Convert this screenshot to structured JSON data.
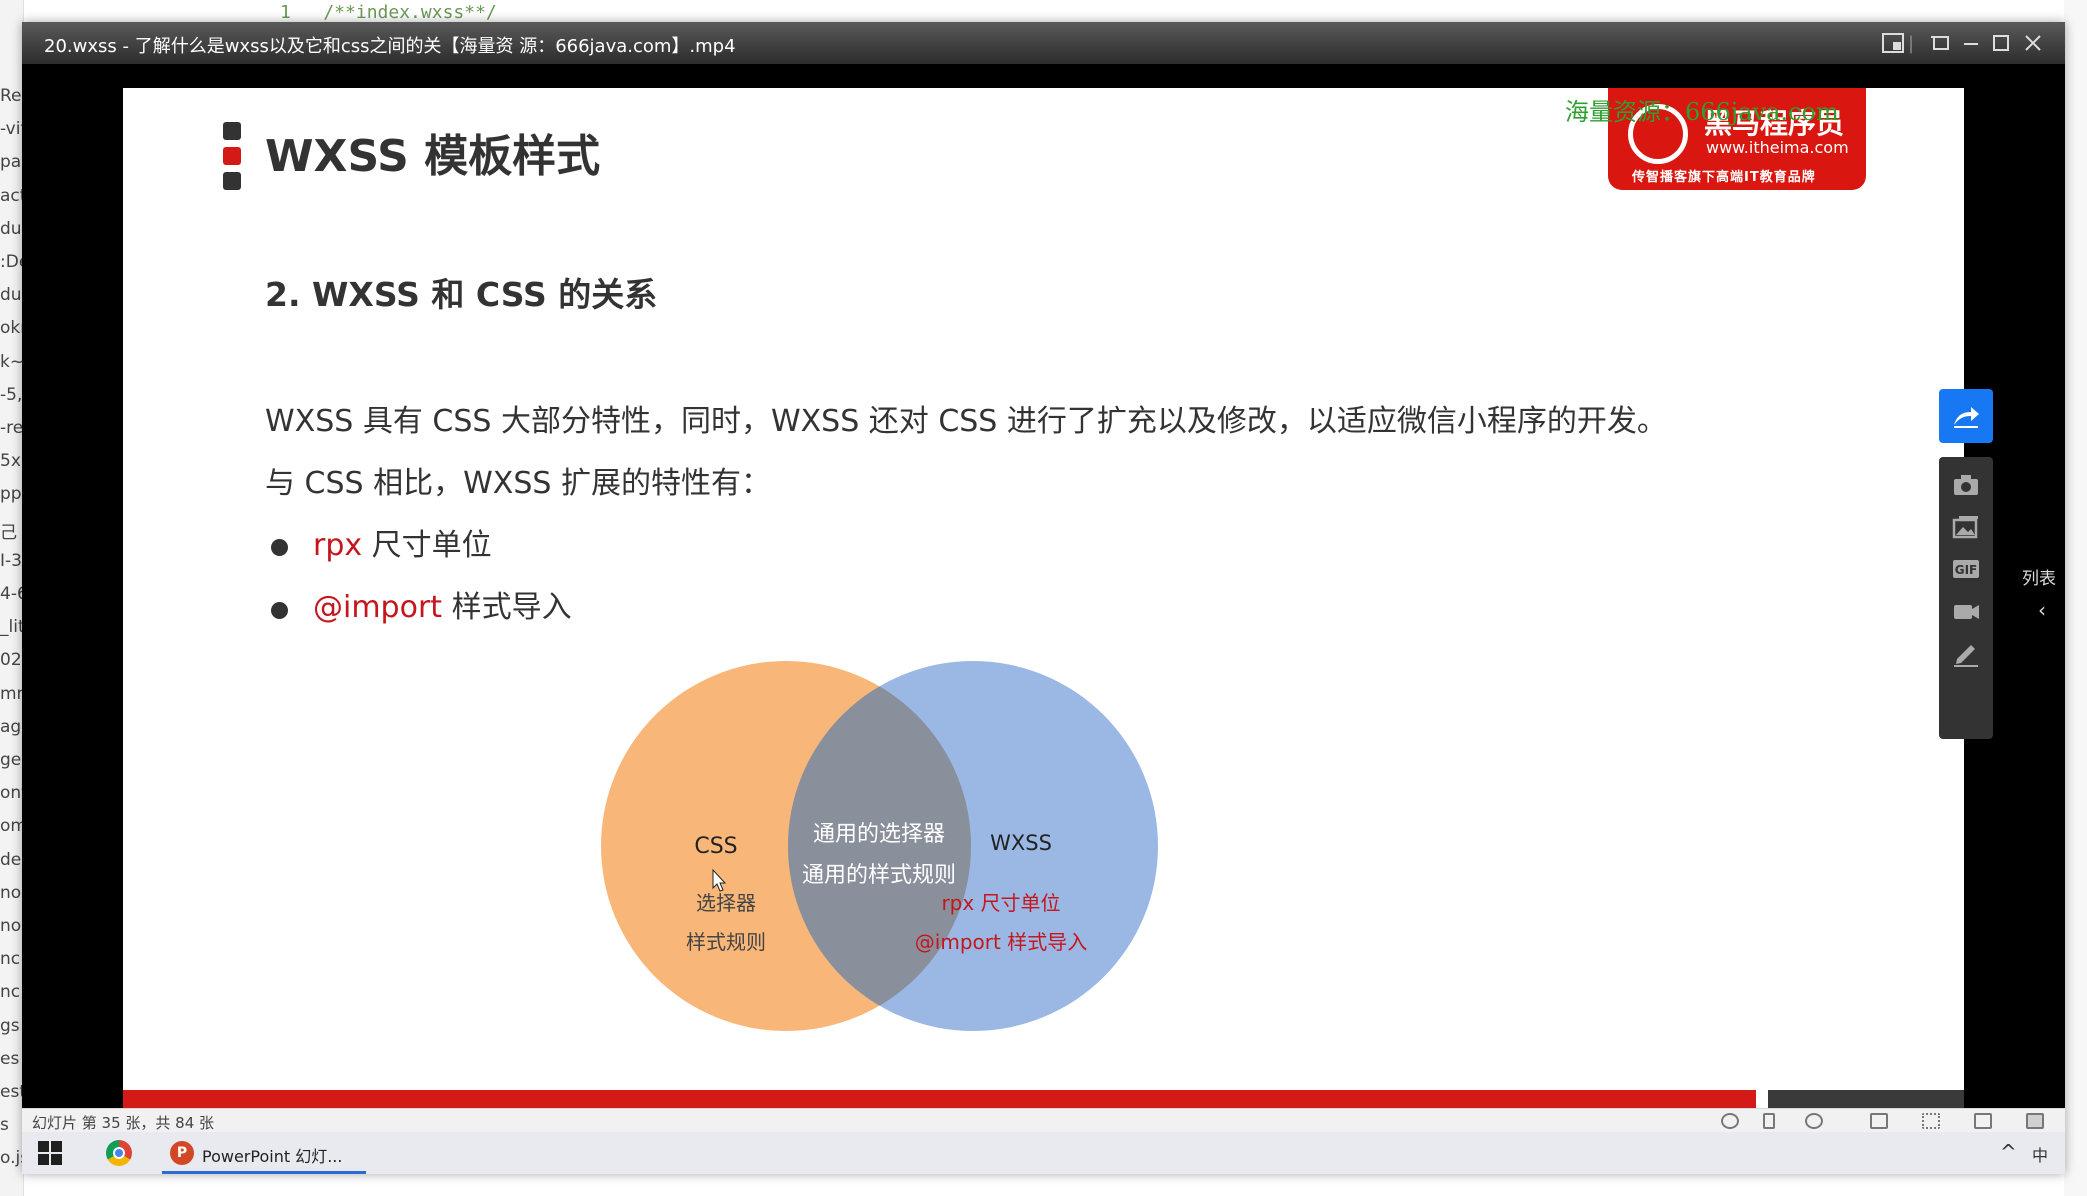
{
  "ide": {
    "code_line_number": "1",
    "code_line_text": "/**index.wxss**/",
    "left_fragments": [
      "Rea",
      "-vit",
      "pac",
      "act",
      "du",
      ":De",
      "dux",
      "okn",
      "k~",
      "-5,",
      "-re",
      "5x",
      "pp",
      "己",
      "I-3",
      "4-6",
      "_lit",
      "02",
      "mm",
      "age",
      "ges",
      "ont",
      "om",
      "de",
      "no",
      "no",
      "nc",
      "nc",
      "gs",
      "es",
      "est",
      "s",
      "o.js"
    ]
  },
  "player": {
    "window_title": "20.wxss - 了解什么是wxss以及它和css之间的关【海量资 源：666java.com】.mp4",
    "side_list_label": "列表",
    "side_list_chevron": "‹",
    "side_tools": [
      "share-icon",
      "camera-icon",
      "picture-icon",
      "gif-icon",
      "video-record-icon",
      "pen-icon"
    ]
  },
  "slide": {
    "title": "WXSS 模板样式",
    "title_mark_colors": [
      "#333333",
      "#d41a16",
      "#333333"
    ],
    "logo": {
      "name": "黑马程序员",
      "url": "www.itheima.com",
      "tagline": "传智播客旗下高端IT教育品牌",
      "color": "#d9160f"
    },
    "watermark": "海量资源：666java.com",
    "subtitle": "2. WXSS 和 CSS 的关系",
    "paragraph1": "WXSS 具有 CSS 大部分特性，同时，WXSS 还对 CSS 进行了扩充以及修改，以适应微信小程序的开发。",
    "paragraph2": "与 CSS 相比，WXSS 扩展的特性有：",
    "bullets": [
      {
        "accent": "rpx",
        "text": " 尺寸单位"
      },
      {
        "accent": "@import",
        "text": " 样式导入"
      }
    ],
    "accent_color": "#c5161d",
    "venn": {
      "left_label": "CSS",
      "left_items": [
        "选择器",
        "样式规则"
      ],
      "overlap_items": [
        "通用的选择器",
        "通用的样式规则"
      ],
      "right_label": "WXSS",
      "right_items": [
        "rpx 尺寸单位",
        "@import 样式导入"
      ],
      "left_color": "#f9b679",
      "right_color": "#8fb0e0"
    }
  },
  "statusbar": {
    "slide_count": "幻灯片 第 35 张，共 84 张"
  },
  "taskbar": {
    "ppt_label": "PowerPoint 幻灯...",
    "ppt_icon_letter": "P",
    "tray_chevron": "^",
    "tray_ime": "中"
  }
}
